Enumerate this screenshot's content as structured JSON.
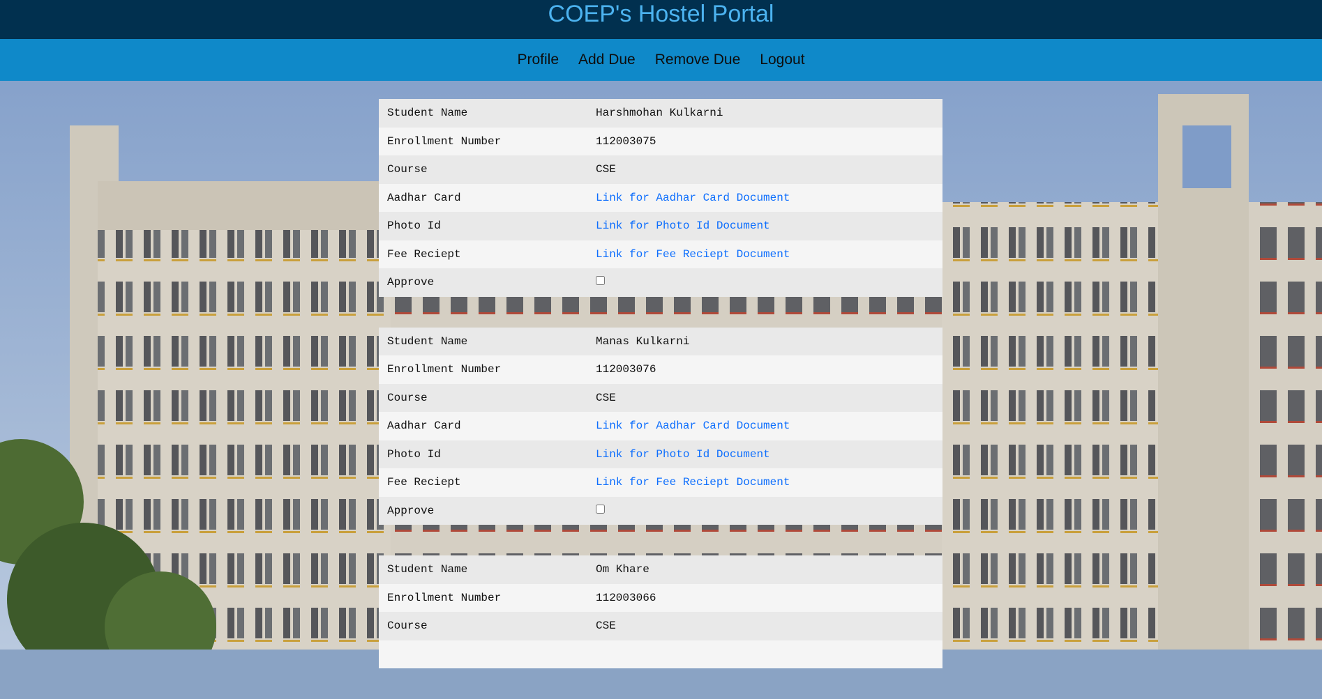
{
  "header": {
    "title": "COEP's Hostel Portal"
  },
  "nav": {
    "items": [
      {
        "label": "Profile"
      },
      {
        "label": "Add Due"
      },
      {
        "label": "Remove Due"
      },
      {
        "label": "Logout"
      }
    ]
  },
  "field_labels": {
    "name": "Student Name",
    "enrollment": "Enrollment Number",
    "course": "Course",
    "aadhar": "Aadhar Card",
    "photo": "Photo Id",
    "fee": "Fee Reciept",
    "approve": "Approve"
  },
  "students": [
    {
      "name": "Harshmohan Kulkarni",
      "enrollment": "112003075",
      "course": "CSE",
      "aadhar_link": "Link for Aadhar Card Document",
      "photo_link": "Link for Photo Id Document",
      "fee_link": "Link for Fee Reciept Document",
      "approved": false
    },
    {
      "name": "Manas Kulkarni",
      "enrollment": "112003076",
      "course": "CSE",
      "aadhar_link": "Link for Aadhar Card Document",
      "photo_link": "Link for Photo Id Document",
      "fee_link": "Link for Fee Reciept Document",
      "approved": false
    },
    {
      "name": "Om Khare",
      "enrollment": "112003066",
      "course": "CSE"
    }
  ],
  "colors": {
    "header_bg": "#01304f",
    "title": "#4cb3f0",
    "nav_bg": "#0f89c9",
    "link": "#0d6efd"
  }
}
